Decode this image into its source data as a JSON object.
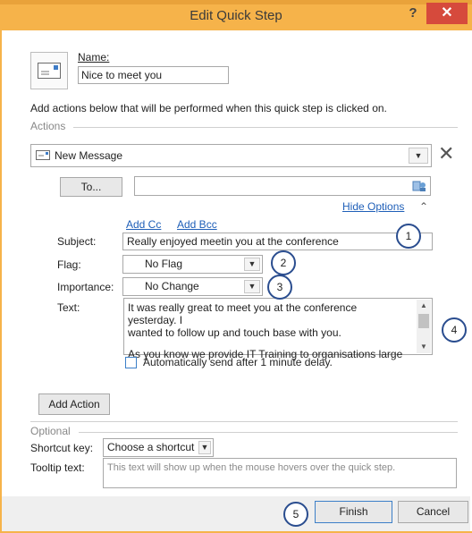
{
  "window": {
    "title": "Edit Quick Step",
    "help_label": "?",
    "close_label": "✕"
  },
  "name": {
    "label": "Name:",
    "value": "Nice to meet you"
  },
  "instructions": "Add actions below that will be performed when this quick step is clicked on.",
  "actions": {
    "section_label": "Actions",
    "action_selected": "New Message",
    "to_button": "To...",
    "to_value": "",
    "hide_options": "Hide Options",
    "add_cc": "Add Cc",
    "add_bcc": "Add Bcc",
    "subject_label": "Subject:",
    "subject_value": "Really enjoyed meetin you at the conference",
    "flag_label": "Flag:",
    "flag_value": "No Flag",
    "importance_label": "Importance:",
    "importance_value": "No Change",
    "text_label": "Text:",
    "text_line1": "It was really great to meet you at the conference yesterday. I",
    "text_line2": "wanted to follow up and touch base with you.",
    "text_line3": "As you know we provide IT Training to organisations large",
    "auto_send_label": "Automatically send after 1 minute delay.",
    "auto_send_checked": false
  },
  "add_action_button": "Add Action",
  "optional": {
    "section_label": "Optional",
    "shortcut_label": "Shortcut key:",
    "shortcut_value": "Choose a shortcut",
    "tooltip_label": "Tooltip text:",
    "tooltip_placeholder": "This text will show up when the mouse hovers over the quick step."
  },
  "footer": {
    "finish_label": "Finish",
    "cancel_label": "Cancel"
  },
  "callouts": [
    "1",
    "2",
    "3",
    "4",
    "5"
  ],
  "colors": {
    "title_bar": "#f6b34a",
    "close": "#d64a3c",
    "link": "#1f5fb8",
    "callout_ring": "#2a4d8f"
  },
  "icons": [
    "message-icon",
    "close-icon",
    "address-book-icon",
    "chevron-up-icon",
    "remove-action-icon"
  ]
}
